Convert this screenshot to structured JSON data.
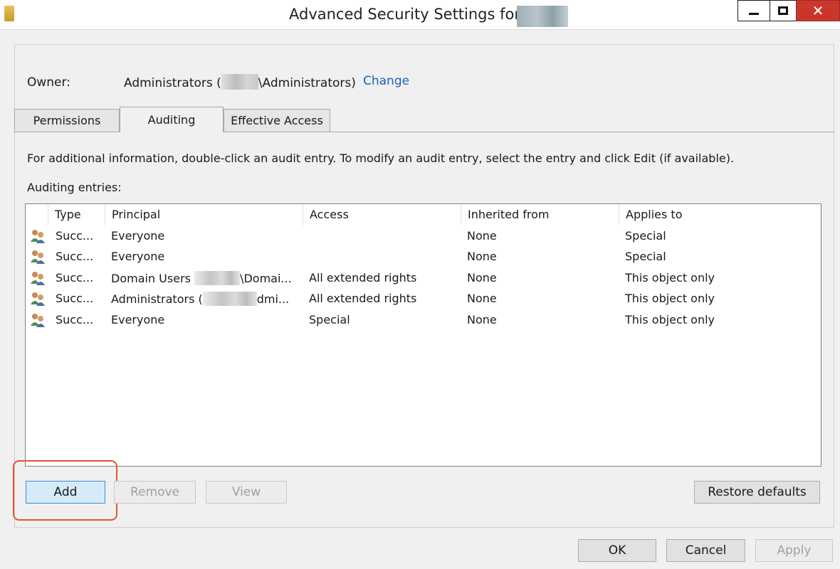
{
  "window": {
    "title": "Advanced Security Settings for",
    "minimize_icon": "minimize-icon",
    "maximize_icon": "maximize-icon",
    "close_symbol": "✕"
  },
  "owner": {
    "label": "Owner:",
    "value_prefix": "Administrators (",
    "value_suffix": "\\Administrators)",
    "change_link": "Change"
  },
  "tabs": [
    {
      "label": "Permissions",
      "active": false
    },
    {
      "label": "Auditing",
      "active": true
    },
    {
      "label": "Effective Access",
      "active": false
    }
  ],
  "info_text": "For additional information, double-click an audit entry. To modify an audit entry, select the entry and click Edit (if available).",
  "entries_label": "Auditing entries:",
  "table": {
    "columns": [
      "Type",
      "Principal",
      "Access",
      "Inherited from",
      "Applies to"
    ],
    "rows": [
      {
        "type": "Succ...",
        "principal_a": "Everyone",
        "principal_b": "",
        "access": "",
        "inherited": "None",
        "applies": "Special"
      },
      {
        "type": "Succ...",
        "principal_a": "Everyone",
        "principal_b": "",
        "access": "",
        "inherited": "None",
        "applies": "Special"
      },
      {
        "type": "Succ...",
        "principal_a": "Domain Users ",
        "principal_b": "\\Domai...",
        "access": "All extended rights",
        "inherited": "None",
        "applies": "This object only"
      },
      {
        "type": "Succ...",
        "principal_a": "Administrators (",
        "principal_b": "dmi...",
        "access": "All extended rights",
        "inherited": "None",
        "applies": "This object only"
      },
      {
        "type": "Succ...",
        "principal_a": "Everyone",
        "principal_b": "",
        "access": "Special",
        "inherited": "None",
        "applies": "This object only"
      }
    ]
  },
  "buttons": {
    "add": "Add",
    "remove": "Remove",
    "view": "View",
    "restore": "Restore defaults",
    "ok": "OK",
    "cancel": "Cancel",
    "apply": "Apply"
  },
  "colors": {
    "link": "#1a62b8",
    "close_button": "#c9372c",
    "highlight": "#e2552e"
  }
}
